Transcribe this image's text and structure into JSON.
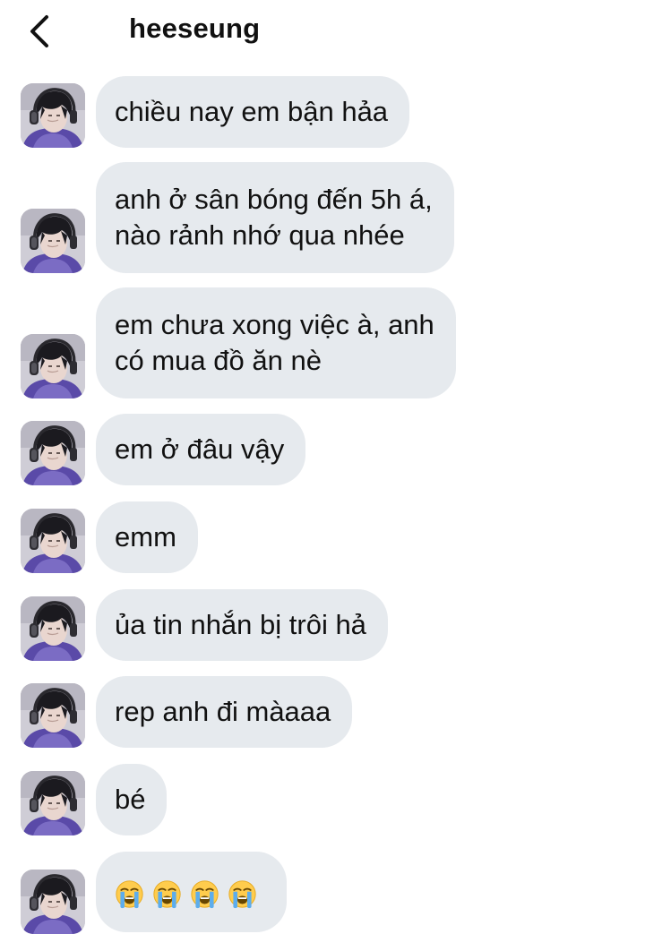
{
  "header": {
    "title": "heeseung",
    "back_icon": "chevron-left-icon"
  },
  "messages": [
    {
      "lines": [
        "chiều nay em bận hảa"
      ]
    },
    {
      "lines": [
        "anh ở sân bóng đến 5h á,",
        "nào rảnh nhớ qua nhée"
      ]
    },
    {
      "lines": [
        "em chưa xong việc à, anh",
        "có mua đồ ăn nè"
      ]
    },
    {
      "lines": [
        "em ở đâu vậy"
      ]
    },
    {
      "lines": [
        "emm"
      ]
    },
    {
      "lines": [
        "ủa tin nhắn bị trôi hả"
      ]
    },
    {
      "lines": [
        "rep anh đi màaaa"
      ]
    },
    {
      "lines": [
        "bé"
      ]
    },
    {
      "emoji": [
        "loudly-crying-face",
        "loudly-crying-face",
        "loudly-crying-face",
        "loudly-crying-face"
      ]
    }
  ],
  "colors": {
    "bubble": "#e6eaee",
    "text": "#111111",
    "background": "#ffffff"
  }
}
